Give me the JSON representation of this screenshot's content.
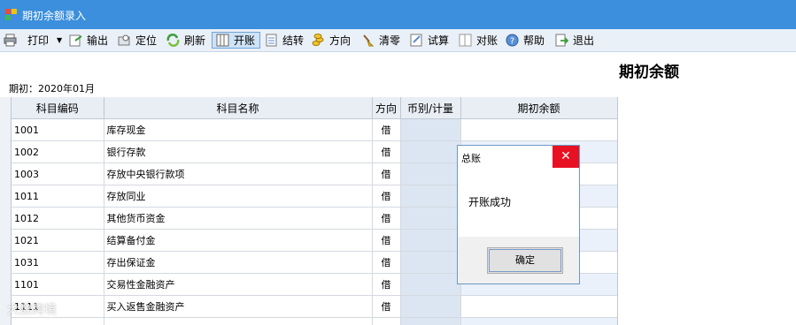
{
  "window": {
    "title": "期初余额录入"
  },
  "toolbar": {
    "print": "打印",
    "export": "输出",
    "locate": "定位",
    "refresh": "刷新",
    "open_account": "开账",
    "transfer": "结转",
    "direction": "方向",
    "clear_zero": "清零",
    "trial_balance": "试算",
    "reconcile": "对账",
    "help": "帮助",
    "exit": "退出"
  },
  "header": {
    "title": "期初余额",
    "period": "期初：2020年01月"
  },
  "table": {
    "columns": [
      "科目编码",
      "科目名称",
      "方向",
      "币别/计量",
      "期初余额"
    ],
    "rows": [
      {
        "code": "1001",
        "name": "库存现金",
        "dir": "借"
      },
      {
        "code": "1002",
        "name": "银行存款",
        "dir": "借"
      },
      {
        "code": "1003",
        "name": "存放中央银行款项",
        "dir": "借"
      },
      {
        "code": "1011",
        "name": "存放同业",
        "dir": "借"
      },
      {
        "code": "1012",
        "name": "其他货币资金",
        "dir": "借"
      },
      {
        "code": "1021",
        "name": "结算备付金",
        "dir": "借"
      },
      {
        "code": "1031",
        "name": "存出保证金",
        "dir": "借"
      },
      {
        "code": "1101",
        "name": "交易性金融资产",
        "dir": "借"
      },
      {
        "code": "1111",
        "name": "买入返售金融资产",
        "dir": "借"
      },
      {
        "code": "",
        "name": "",
        "dir": ""
      }
    ]
  },
  "dialog": {
    "title": "总账",
    "message": "开账成功",
    "ok": "确定",
    "close": "✕"
  },
  "watermark": "大数跨境",
  "colors": {
    "titlebar": "#3b8fdc",
    "close_red": "#e81123",
    "currency_col": "#dce6f2"
  }
}
